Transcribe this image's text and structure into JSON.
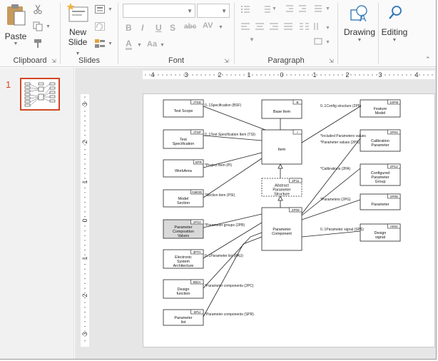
{
  "ribbon": {
    "clipboard": {
      "label": "Clipboard",
      "paste": "Paste"
    },
    "slides": {
      "label": "Slides",
      "new_slide_line1": "New",
      "new_slide_line2": "Slide"
    },
    "font": {
      "label": "Font",
      "bold": "B",
      "italic": "I",
      "underline": "U",
      "strike": "S",
      "font_color": "A",
      "spacing": "AV",
      "change_case": "Aa"
    },
    "paragraph": {
      "label": "Paragraph"
    },
    "drawing": {
      "label": "Drawing"
    },
    "editing": {
      "label": "Editing"
    }
  },
  "slide_panel": {
    "slide_number": "1"
  },
  "rulers": {
    "horizontal": [
      "4",
      "3",
      "2",
      "1",
      "0",
      "1",
      "2",
      "3",
      "4"
    ],
    "vertical": [
      "3",
      "2",
      "1",
      "0",
      "1",
      "2",
      "3"
    ]
  },
  "diagram": {
    "boxes": [
      {
        "code": "JTSD",
        "name": "Test Scope"
      },
      {
        "code": "JTSP",
        "name": "Test Specification"
      },
      {
        "code": "SPR",
        "name": "WorkArea"
      },
      {
        "code": "NMOD",
        "name": "Model Section"
      },
      {
        "code": "2P10",
        "name": "Parameter Composition Values"
      },
      {
        "code": "3PTA",
        "name": "Electronic System Architecture"
      },
      {
        "code": "BIDA",
        "name": "Design function"
      },
      {
        "code": "SPLI",
        "name": "Parameter list"
      },
      {
        "code": "B",
        "name": "Base Item"
      },
      {
        "code": "I",
        "name": "Item"
      },
      {
        "code": "2P11",
        "name": "Abstract Parameter Structure"
      },
      {
        "code": "2P09",
        "name": "Parameter Component"
      },
      {
        "code": "10FM",
        "name": "Feature Model"
      },
      {
        "code": "2P04",
        "name": "Calibration Parameter"
      },
      {
        "code": "2P12",
        "name": "Configured Parameter Group"
      },
      {
        "code": "2P08",
        "name": "Parameter"
      },
      {
        "code": "ARSI",
        "name": "Design signal"
      }
    ],
    "edge_labels": [
      "0..1Specification (BSF)",
      "0..1Test Specification Item (TSI)",
      "*Project Item (PI)",
      "*Section item (PSI)",
      "*Parameter groups (2PB)",
      "0..1Parameter list (PAU)",
      "*Parameter components (2PC)",
      "*Parameter components (SPR)",
      "0..1Config structure (2P6)",
      "*Included Parameters values",
      "*Parameter values (2PS)",
      "*Calibrations (2PA)",
      "*Parameters (2PG)",
      "0..1Parameter signal (SPS)"
    ]
  }
}
